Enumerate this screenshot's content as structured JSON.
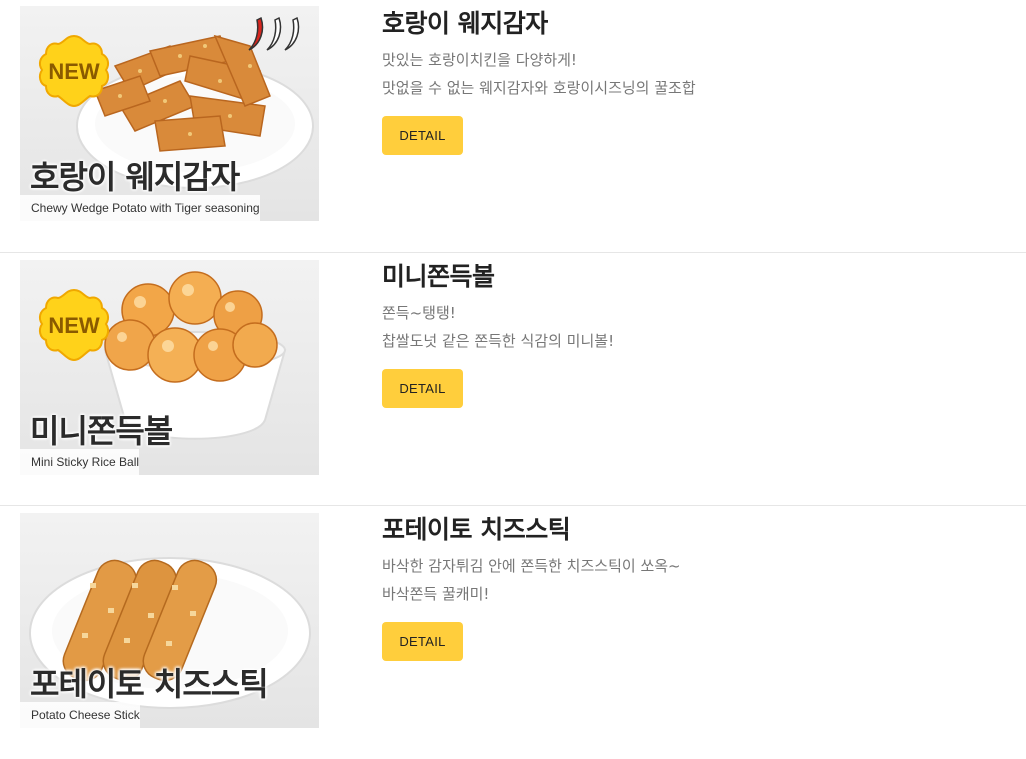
{
  "products": [
    {
      "name": "호랑이 웨지감자",
      "image_title": "호랑이 웨지감자",
      "image_subtitle": "Chewy Wedge Potato with Tiger seasoning",
      "badge": "NEW",
      "spicy_icon": "chili-pepper-icon",
      "desc_line1": "맛있는 호랑이치킨을 다양하게!",
      "desc_line2": "맛없을 수 없는 웨지감자와 호랑이시즈닝의 꿀조합",
      "button": "DETAIL"
    },
    {
      "name": "미니쫀득볼",
      "image_title": "미니쫀득볼",
      "image_subtitle": "Mini Sticky Rice Ball",
      "badge": "NEW",
      "desc_line1": "쫀득~탱탱!",
      "desc_line2": "찹쌀도넛 같은 쫀득한 식감의 미니볼!",
      "button": "DETAIL"
    },
    {
      "name": "포테이토 치즈스틱",
      "image_title": "포테이토 치즈스틱",
      "image_subtitle": "Potato Cheese Stick",
      "desc_line1": "바삭한 감자튀김 안에 쫀득한 치즈스틱이 쏘옥~",
      "desc_line2": "바삭쫀득 꿀캐미!",
      "button": "DETAIL"
    }
  ],
  "colors": {
    "button_bg": "#ffce3c",
    "badge": "#ffd21a",
    "divider": "#e6e6e6"
  }
}
